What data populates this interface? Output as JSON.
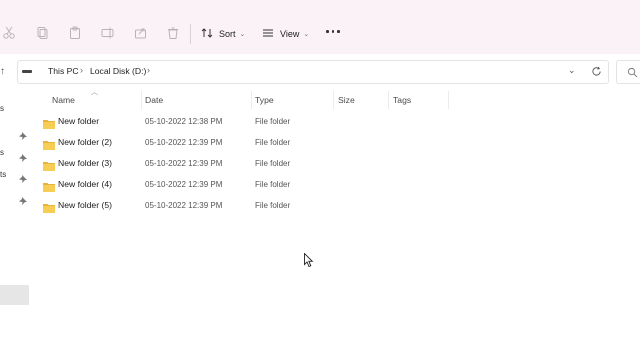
{
  "toolbar": {
    "icons": [
      "cut-icon",
      "copy-icon",
      "paste-icon",
      "rename-icon",
      "share-icon",
      "delete-icon"
    ],
    "sort_label": "Sort",
    "view_label": "View",
    "more_icon": "more-icon"
  },
  "address": {
    "crumbs": [
      "This PC",
      "Local Disk (D:)"
    ],
    "separator": "›"
  },
  "columns": {
    "name": "Name",
    "date": "Date",
    "type": "Type",
    "size": "Size",
    "tags": "Tags"
  },
  "files": [
    {
      "name": "New folder",
      "date": "05-10-2022 12:38 PM",
      "type": "File folder"
    },
    {
      "name": "New folder (2)",
      "date": "05-10-2022 12:39 PM",
      "type": "File folder"
    },
    {
      "name": "New folder (3)",
      "date": "05-10-2022 12:39 PM",
      "type": "File folder"
    },
    {
      "name": "New folder (4)",
      "date": "05-10-2022 12:39 PM",
      "type": "File folder"
    },
    {
      "name": "New folder (5)",
      "date": "05-10-2022 12:39 PM",
      "type": "File folder"
    }
  ],
  "nav": {
    "fragments": [
      "s",
      "s",
      "ts"
    ]
  },
  "colors": {
    "toolbar_bg": "#fbf2f7",
    "folder": "#f2c94c"
  }
}
